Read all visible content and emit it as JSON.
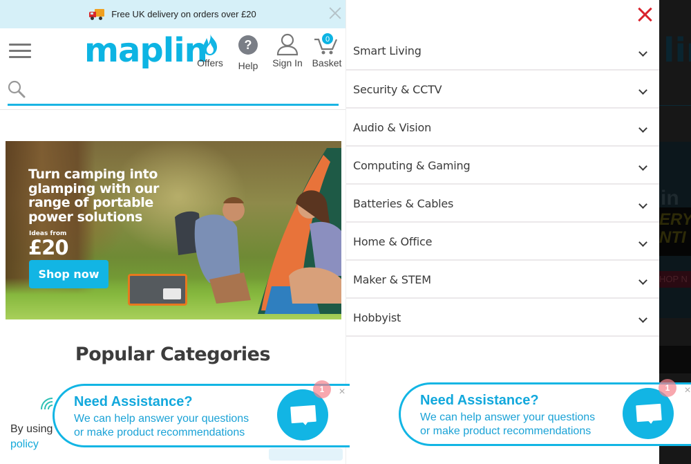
{
  "promo_bar": {
    "icon": "delivery-truck-icon",
    "text": "Free UK delivery on orders over £20",
    "close_icon": "close-icon"
  },
  "header": {
    "menu_icon": "hamburger-menu-icon",
    "logo": "maplin",
    "nav": [
      {
        "id": "offers",
        "label": "Offers",
        "icon": "flame-icon"
      },
      {
        "id": "help",
        "label": "Help",
        "icon": "question-circle-icon",
        "glyph": "?"
      },
      {
        "id": "signin",
        "label": "Sign In",
        "icon": "user-icon"
      },
      {
        "id": "basket",
        "label": "Basket",
        "icon": "shopping-cart-icon",
        "count": "0"
      }
    ]
  },
  "search": {
    "icon": "search-icon",
    "value": "",
    "placeholder": ""
  },
  "hero": {
    "title": "Turn camping into glamping with our range of portable power solutions",
    "subtitle": "Ideas from",
    "price": "£20",
    "cta": "Shop now"
  },
  "popular": {
    "title": "Popular Categories"
  },
  "cookie": {
    "text": "By using",
    "link": "policy"
  },
  "chat": {
    "title": "Need Assistance?",
    "line1": "We can help answer your questions",
    "line2": "or make product recommendations",
    "badge": "1",
    "close": "×",
    "icon": "chat-bubble-icon"
  },
  "drawer": {
    "close_icon": "close-icon",
    "accent": "#d9232d",
    "items": [
      {
        "label": "Smart Living"
      },
      {
        "label": "Security & CCTV"
      },
      {
        "label": "Audio & Vision"
      },
      {
        "label": "Computing & Gaming"
      },
      {
        "label": "Batteries & Cables"
      },
      {
        "label": "Home & Office"
      },
      {
        "label": "Maker & STEM"
      },
      {
        "label": "Hobbyist"
      }
    ]
  },
  "overlay": {
    "ghost_logo": "lin",
    "ghost_in": "in",
    "ghost_banner": "ERY\nNTI",
    "ghost_cta": "HOP N"
  },
  "colors": {
    "brand": "#0db4e3",
    "promo_bg": "#d6f0f8",
    "close_red": "#d9232d"
  }
}
